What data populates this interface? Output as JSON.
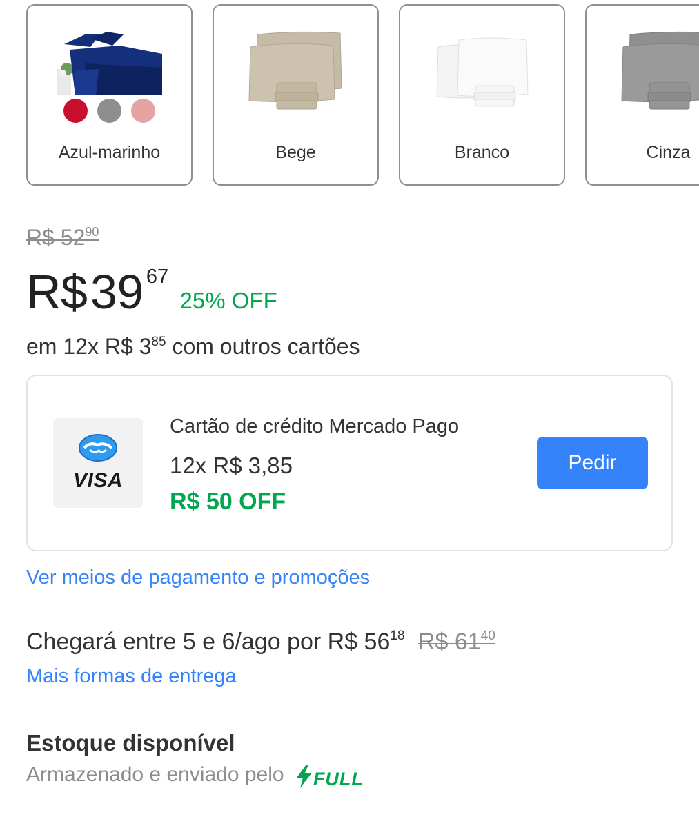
{
  "variants": [
    {
      "name": "Azul-marinho",
      "selected": false
    },
    {
      "name": "Bege",
      "selected": false
    },
    {
      "name": "Branco",
      "selected": false
    },
    {
      "name": "Cinza",
      "selected": false
    }
  ],
  "swatch_colors": [
    "#c8102e",
    "#8e8e8e",
    "#e5a3a3"
  ],
  "pricing": {
    "old_currency": "R$",
    "old_int": "52",
    "old_cents": "90",
    "currency": "R$",
    "price_int": "39",
    "price_cents": "67",
    "discount": "25% OFF",
    "installments_prefix": "em 12x R$ 3",
    "installments_cents": "85",
    "installments_suffix": "com outros cartões"
  },
  "mp_card": {
    "logo_text": "VISA",
    "title": "Cartão de crédito Mercado Pago",
    "installments": "12x R$ 3,85",
    "discount": "R$ 50 OFF",
    "button": "Pedir"
  },
  "links": {
    "payment": "Ver meios de pagamento e promoções",
    "delivery": "Mais formas de entrega"
  },
  "shipping": {
    "text": "Chegará entre 5 e 6/ago por R$ 56",
    "cents": "18",
    "old_int": "R$ 61",
    "old_cents": "40"
  },
  "stock": {
    "title": "Estoque disponível",
    "subtitle": "Armazenado e enviado pelo",
    "badge": "FULL"
  },
  "colors": {
    "accent_blue": "#3483fa",
    "green": "#00a650"
  }
}
